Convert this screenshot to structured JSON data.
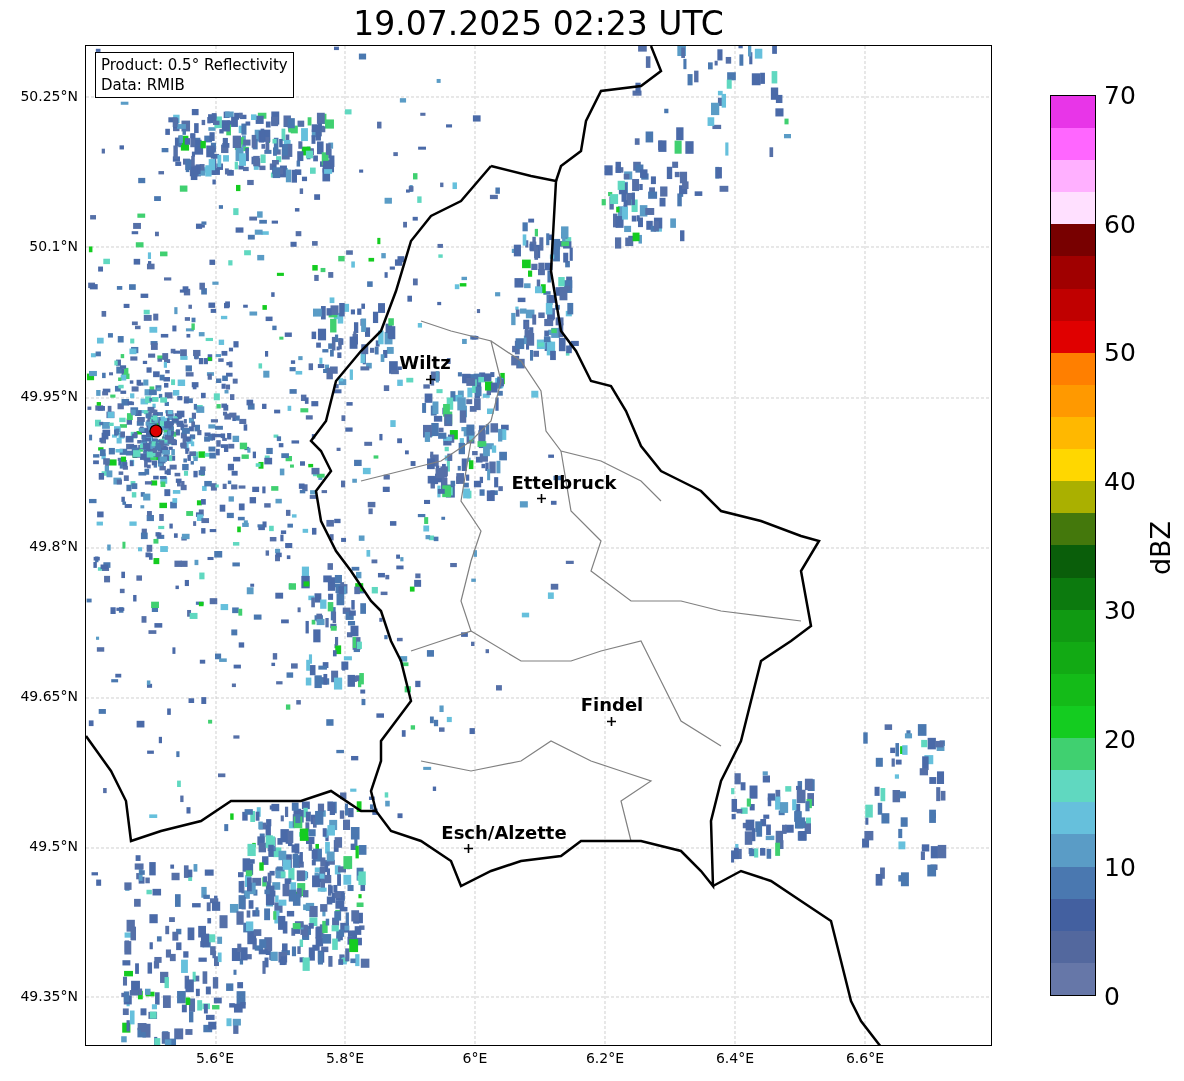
{
  "title": "19.07.2025 02:23 UTC",
  "legend": [
    "Product: 0.5° Reflectivity",
    "Data: RMIB"
  ],
  "cities": [
    {
      "name": "Wiltz"
    },
    {
      "name": "Ettelbruck"
    },
    {
      "name": "Findel"
    },
    {
      "name": "Esch/Alzette"
    }
  ],
  "x_ticks": [
    "5.6°E",
    "5.8°E",
    "6°E",
    "6.2°E",
    "6.4°E",
    "6.6°E"
  ],
  "y_ticks": [
    "50.25°N",
    "50.1°N",
    "49.95°N",
    "49.8°N",
    "49.65°N",
    "49.5°N",
    "49.35°N"
  ],
  "colorbar": {
    "label": "dBZ",
    "ticks": [
      "70",
      "60",
      "50",
      "40",
      "30",
      "20",
      "10",
      "0"
    ],
    "bands": [
      {
        "color": "#6677a8"
      },
      {
        "color": "#53689e"
      },
      {
        "color": "#4360a0"
      },
      {
        "color": "#4a78b0"
      },
      {
        "color": "#5a9cc6"
      },
      {
        "color": "#66c0dc"
      },
      {
        "color": "#60d8c0"
      },
      {
        "color": "#40d070"
      },
      {
        "color": "#14cc20"
      },
      {
        "color": "#14bb18"
      },
      {
        "color": "#12aa14"
      },
      {
        "color": "#109a12"
      },
      {
        "color": "#0c7a0e"
      },
      {
        "color": "#0a5e0a"
      },
      {
        "color": "#44780c"
      },
      {
        "color": "#aab000"
      },
      {
        "color": "#ffd700"
      },
      {
        "color": "#ffb800"
      },
      {
        "color": "#ff9900"
      },
      {
        "color": "#ff7f00"
      },
      {
        "color": "#e00000"
      },
      {
        "color": "#c00000"
      },
      {
        "color": "#a00000"
      },
      {
        "color": "#780000"
      },
      {
        "color": "#ffe0ff"
      },
      {
        "color": "#ffb0ff"
      },
      {
        "color": "#ff66ff"
      },
      {
        "color": "#e835e8"
      }
    ]
  }
}
